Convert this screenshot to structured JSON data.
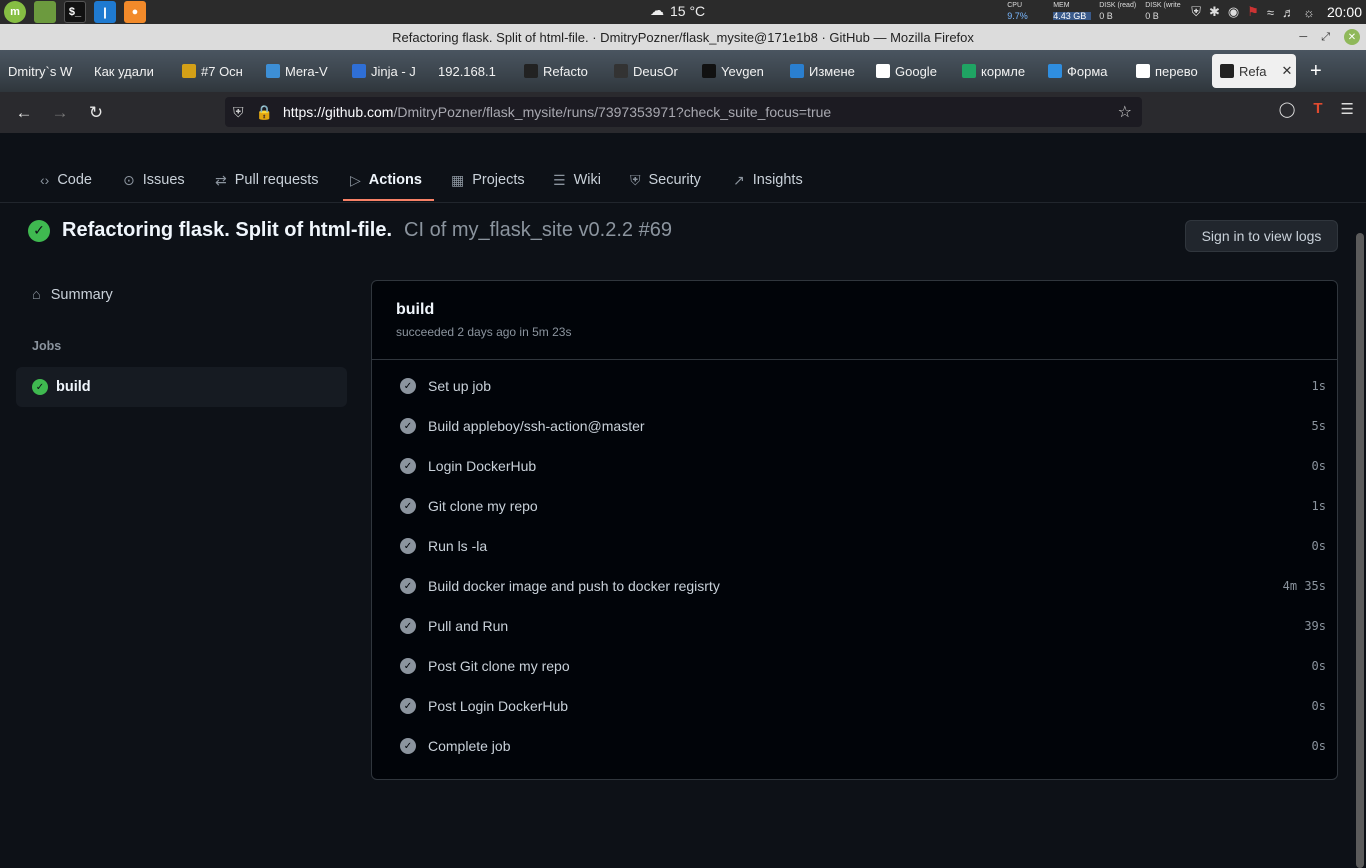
{
  "panel": {
    "weather": "15 °C",
    "cpu_label": "CPU",
    "cpu_value": "9.7%",
    "mem_label": "MEM",
    "mem_value": "4.43 GB",
    "disk_read_label": "DISK (read)",
    "disk_read_value": "0 B",
    "disk_write_label": "DISK (write",
    "disk_write_value": "0 B",
    "clock": "20:00"
  },
  "window": {
    "title": "Refactoring flask. Split of html-file. · DmitryPozner/flask_mysite@171e1b8 · GitHub — Mozilla Firefox"
  },
  "tabs": [
    {
      "label": "Dmitry`s W",
      "color": "#555"
    },
    {
      "label": "Как удали",
      "color": "#555"
    },
    {
      "label": "#7 Осн",
      "color": "#d4a017"
    },
    {
      "label": "Mera-V",
      "color": "#3d8fd6"
    },
    {
      "label": "Jinja - J",
      "color": "#2f6fd6"
    },
    {
      "label": "192.168.1",
      "color": "#555"
    },
    {
      "label": "Refacto",
      "color": "#222"
    },
    {
      "label": "DeusOr",
      "color": "#333"
    },
    {
      "label": "Yevgen",
      "color": "#111"
    },
    {
      "label": "Измене",
      "color": "#2a7fd0"
    },
    {
      "label": "Google",
      "color": "#fff"
    },
    {
      "label": "кормле",
      "color": "#1fa463"
    },
    {
      "label": "Форма",
      "color": "#2f8ee0"
    },
    {
      "label": "перево",
      "color": "#fff"
    },
    {
      "label": "Refa",
      "color": "#222"
    }
  ],
  "urlbar": {
    "url_host": "https://github.com",
    "url_rest": "/DmitryPozner/flask_mysite/runs/7397353971?check_suite_focus=true"
  },
  "repo_tabs": [
    {
      "label": "Code",
      "icon": "code-icon"
    },
    {
      "label": "Issues",
      "icon": "issue-icon"
    },
    {
      "label": "Pull requests",
      "icon": "pull-request-icon"
    },
    {
      "label": "Actions",
      "icon": "play-icon"
    },
    {
      "label": "Projects",
      "icon": "table-icon"
    },
    {
      "label": "Wiki",
      "icon": "book-icon"
    },
    {
      "label": "Security",
      "icon": "shield-icon"
    },
    {
      "label": "Insights",
      "icon": "graph-icon"
    }
  ],
  "run": {
    "title": "Refactoring flask. Split of html-file.",
    "subtitle": "CI of my_flask_site v0.2.2 #69",
    "signin_label": "Sign in to view logs"
  },
  "sidebar": {
    "summary_label": "Summary",
    "jobs_heading": "Jobs",
    "job_label": "build"
  },
  "job": {
    "name": "build",
    "meta": "succeeded 2 days ago in 5m 23s",
    "steps": [
      {
        "name": "Set up job",
        "time": "1s"
      },
      {
        "name": "Build appleboy/ssh-action@master",
        "time": "5s"
      },
      {
        "name": "Login DockerHub",
        "time": "0s"
      },
      {
        "name": "Git clone my repo",
        "time": "1s"
      },
      {
        "name": "Run ls -la",
        "time": "0s"
      },
      {
        "name": "Build docker image and push to docker regisrty",
        "time": "4m 35s"
      },
      {
        "name": "Pull and Run",
        "time": "39s"
      },
      {
        "name": "Post Git clone my repo",
        "time": "0s"
      },
      {
        "name": "Post Login DockerHub",
        "time": "0s"
      },
      {
        "name": "Complete job",
        "time": "0s"
      }
    ]
  },
  "colors": {
    "success": "#3fb950",
    "accent_underline": "#f78166",
    "bg": "#0d1117"
  }
}
